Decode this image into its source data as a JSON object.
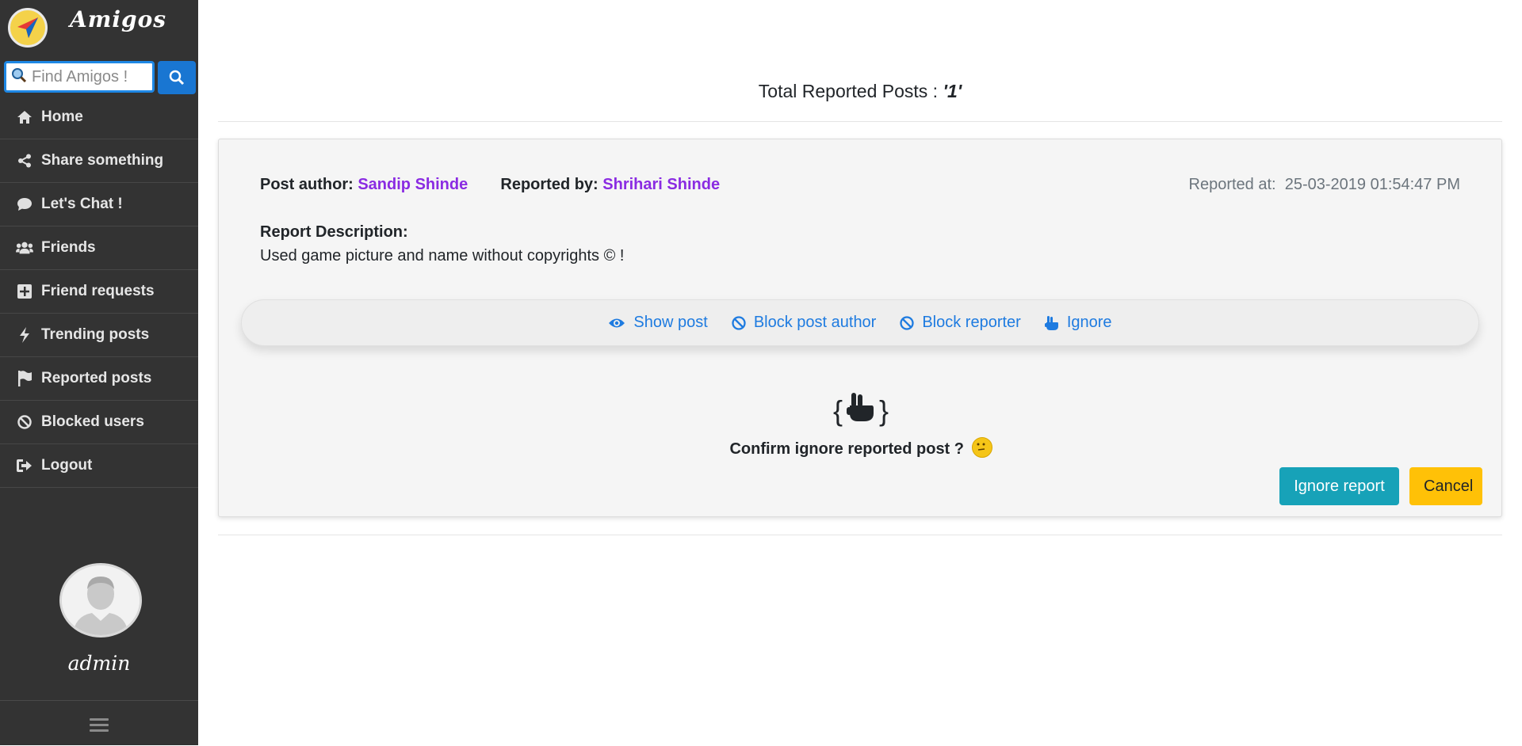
{
  "app": {
    "brand": "Amigos"
  },
  "search": {
    "placeholder": "Find Amigos !"
  },
  "nav": [
    {
      "label": "Home",
      "icon": "home-icon"
    },
    {
      "label": "Share something",
      "icon": "share-icon"
    },
    {
      "label": "Let's Chat !",
      "icon": "chat-icon"
    },
    {
      "label": "Friends",
      "icon": "users-icon"
    },
    {
      "label": "Friend requests",
      "icon": "plus-square-icon"
    },
    {
      "label": "Trending posts",
      "icon": "bolt-icon"
    },
    {
      "label": "Reported posts",
      "icon": "flag-icon"
    },
    {
      "label": "Blocked users",
      "icon": "ban-icon"
    },
    {
      "label": "Logout",
      "icon": "sign-out-icon"
    }
  ],
  "user": {
    "name": "admin"
  },
  "main": {
    "total_label": "Total Reported Posts : ",
    "total_value": "'1'",
    "report": {
      "author_label": "Post author:",
      "author_name": "Sandip Shinde",
      "reporter_label": "Reported by:",
      "reporter_name": "Shrihari Shinde",
      "reported_at_label": "Reported at:",
      "reported_at": "25-03-2019 01:54:47 PM",
      "description_label": "Report Description:",
      "description": "Used game picture and name without copyrights © !"
    },
    "actions": {
      "show_post": "Show post",
      "block_author": "Block post author",
      "block_reporter": "Block reporter",
      "ignore": "Ignore"
    },
    "confirm": {
      "brace_open": "{",
      "brace_close": "}",
      "text": "Confirm ignore reported post ?",
      "ignore_button": "Ignore report",
      "cancel_button": "Cancel"
    }
  },
  "colors": {
    "sidebar_bg": "#333333",
    "link": "#1e7be0",
    "name": "#8a2be2",
    "ignore_btn": "#17a2b8",
    "cancel_btn": "#ffc107"
  }
}
